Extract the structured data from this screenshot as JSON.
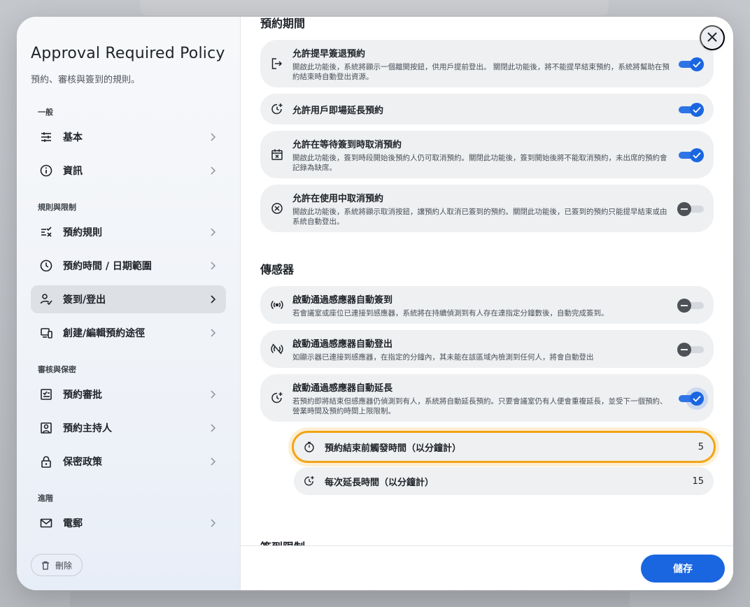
{
  "sidebar": {
    "title": "Approval Required Policy",
    "subtitle": "預約、審核與簽到的規則。",
    "sections": {
      "general": "一般",
      "rules": "規則與限制",
      "review": "審核與保密",
      "advanced": "進階"
    },
    "items": {
      "basic": "基本",
      "info": "資訊",
      "booking_rules": "預約規則",
      "booking_time": "預約時間 / 日期範圍",
      "checkin": "簽到/登出",
      "channels": "創建/編輯預約途徑",
      "approval": "預約審批",
      "host": "預約主持人",
      "privacy": "保密政策",
      "email": "電郵"
    },
    "delete_label": "刪除"
  },
  "main": {
    "period_title": "預約期間",
    "sensor_title": "傳感器",
    "next_title": "簽到限制",
    "cards": {
      "early_checkout": {
        "title": "允許提早簽退預約",
        "desc": "開啟此功能後，系統將顯示一個離開按鈕，供用戶提前登出。 關閉此功能後，將不能提早結束預約，系統將幫助在預約結束時自動登出資源。",
        "on": true
      },
      "extend": {
        "title": "允許用戶即場延長預約",
        "on": true
      },
      "cancel_waiting": {
        "title": "允許在等待簽到時取消預約",
        "desc": "開啟此功能後，簽到時段開始後預約人仍可取消預約。關閉此功能後，簽到開始後將不能取消預約，未出席的預約會記錄為缺席。",
        "on": true
      },
      "cancel_in_use": {
        "title": "允許在使用中取消預約",
        "desc": "開啟此功能後，系統將顯示取消按鈕，讓預約人取消已簽到的預約。關閉此功能後，已簽到的預約只能提早結束或由系統自動登出。",
        "on": false
      },
      "sensor_checkin": {
        "title": "啟動通過感應器自動簽到",
        "desc": "若會議室或座位已連接到感應器，系統將在持續偵測到有人存在達指定分鐘數後，自動完成簽到。",
        "on": false
      },
      "sensor_checkout": {
        "title": "啟動通過感應器自動登出",
        "desc": "如顯示器已連接到感應器，在指定的分鐘內，其未能在該區域內檢測到任何人，將會自動登出",
        "on": false
      },
      "sensor_extend": {
        "title": "啟動通過感應器自動延長",
        "desc": "若預約即將結束但感應器仍偵測到有人，系統將自動延長預約。只要會議室仍有人便會重複延長，並受下一個預約、營業時間及預約時間上限限制。",
        "on": true
      }
    },
    "sub": {
      "trigger_label": "預約結束前觸發時間（以分鐘計）",
      "trigger_value": "5",
      "extend_label": "每次延長時間（以分鐘計）",
      "extend_value": "15"
    }
  },
  "footer": {
    "save_label": "儲存"
  },
  "colors": {
    "accent": "#1a66e0",
    "focus": "#f2a517"
  }
}
